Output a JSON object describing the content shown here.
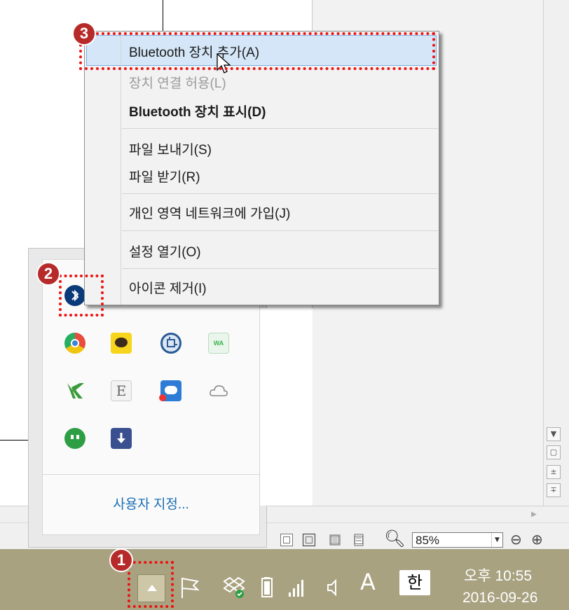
{
  "context_menu": {
    "items": [
      {
        "label": "Bluetooth 장치 추가(A)",
        "state": "highlighted"
      },
      {
        "label": "장치 연결 허용(L)",
        "state": "disabled"
      },
      {
        "label": "Bluetooth 장치 표시(D)",
        "state": "bold"
      },
      {
        "label": "파일 보내기(S)",
        "state": "normal"
      },
      {
        "label": "파일 받기(R)",
        "state": "normal"
      },
      {
        "label": "개인 영역 네트워크에 가입(J)",
        "state": "normal"
      },
      {
        "label": "설정 열기(O)",
        "state": "normal"
      },
      {
        "label": "아이콘 제거(I)",
        "state": "normal"
      }
    ]
  },
  "tray_popup": {
    "icons": [
      {
        "name": "bluetooth-icon",
        "color": "#0a3a7a"
      },
      {
        "name": "chrome-icon",
        "color": "#e74c3c"
      },
      {
        "name": "kakaotalk-icon",
        "color": "#f7d51d"
      },
      {
        "name": "screen-capture-icon",
        "color": "#2b5a96"
      },
      {
        "name": "wa-icon",
        "color": "#3ab54a"
      },
      {
        "name": "vpn-icon",
        "color": "#3a9b3a"
      },
      {
        "name": "evernote-e-icon",
        "color": "#777777"
      },
      {
        "name": "cloud-storage-icon",
        "color": "#2f7cd6"
      },
      {
        "name": "onedrive-cloud-icon",
        "color": "#888888"
      },
      {
        "name": "hangouts-icon",
        "color": "#2e9e45"
      },
      {
        "name": "download-icon",
        "color": "#3a4f8f"
      }
    ],
    "customize_label": "사용자 지정..."
  },
  "status_bar": {
    "zoom_value": "85%"
  },
  "taskbar": {
    "time": "오후 10:55",
    "date": "2016-09-26",
    "ime_language": "A",
    "ime_korean": "한",
    "icons": [
      "show-hidden-icons-icon",
      "action-center-flag-icon",
      "dropbox-icon",
      "battery-icon",
      "signal-icon",
      "volume-icon",
      "ime-mode-icon",
      "hangul-icon"
    ]
  },
  "annotations": {
    "badge_1": "1",
    "badge_2": "2",
    "badge_3": "3"
  },
  "colors": {
    "taskbar": "#a8a280",
    "highlight": "#d4e6f7",
    "annotation_red": "#e11111",
    "badge": "#b72a2a",
    "link": "#1a6fb6"
  }
}
